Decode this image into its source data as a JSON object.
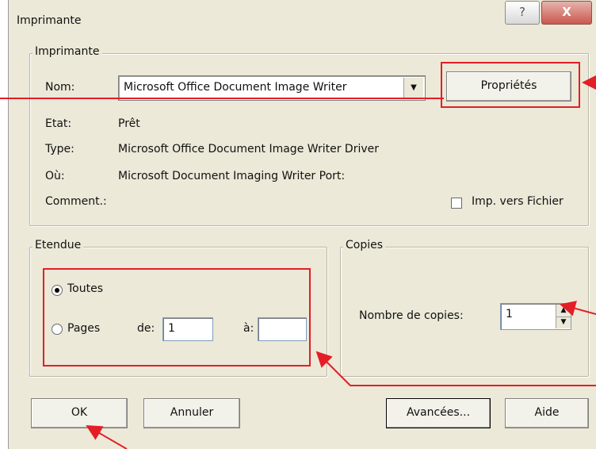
{
  "window": {
    "title": "Imprimante"
  },
  "titlebar": {
    "help_glyph": "?",
    "close_glyph": "X"
  },
  "printer": {
    "legend": "Imprimante",
    "name_label": "Nom:",
    "name_value": "Microsoft Office Document Image Writer",
    "properties_button": "Propriétés",
    "status_label": "Etat:",
    "status_value": "Prêt",
    "type_label": "Type:",
    "type_value": "Microsoft Office Document Image Writer Driver",
    "where_label": "Où:",
    "where_value": "Microsoft Document Imaging Writer Port:",
    "comment_label": "Comment.:",
    "print_to_file_label": "Imp. vers Fichier",
    "print_to_file_checked": false
  },
  "range": {
    "legend": "Etendue",
    "all_label": "Toutes",
    "pages_label": "Pages",
    "from_label": "de:",
    "from_value": "1",
    "to_label": "à:",
    "to_value": "",
    "selected": "all"
  },
  "copies": {
    "legend": "Copies",
    "count_label": "Nombre de copies:",
    "count_value": "1"
  },
  "buttons": {
    "ok": "OK",
    "cancel": "Annuler",
    "advanced": "Avancées...",
    "help": "Aide"
  },
  "icons": {
    "dropdown": "triangle-down",
    "spin_up": "triangle-up",
    "spin_down": "triangle-down"
  },
  "colors": {
    "dialog_bg": "#ece9d8",
    "annotation_red": "#e41e26",
    "close_button": "#c9584d"
  }
}
